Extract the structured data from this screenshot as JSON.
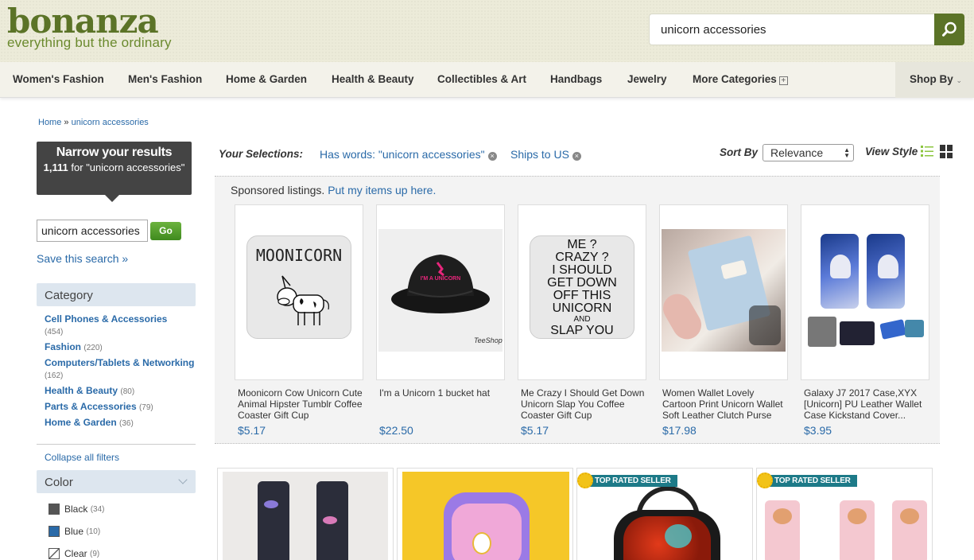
{
  "header": {
    "logo_word": "bonanza",
    "logo_tagline": "everything but the ordinary",
    "search_value": "unicorn accessories"
  },
  "nav": {
    "items": [
      "Women's Fashion",
      "Men's Fashion",
      "Home & Garden",
      "Health & Beauty",
      "Collectibles & Art",
      "Handbags",
      "Jewelry",
      "More Categories"
    ],
    "shop_by": "Shop By"
  },
  "breadcrumb": {
    "home": "Home",
    "separator": "»",
    "current": "unicorn accessories"
  },
  "narrow": {
    "title": "Narrow your results",
    "count": "1,111",
    "for_text": "for \"unicorn accessories\""
  },
  "side_search": {
    "value": "unicorn accessories",
    "go": "Go",
    "save": "Save this search »"
  },
  "category": {
    "heading": "Category",
    "items": [
      {
        "label": "Cell Phones & Accessories",
        "count": "(454)"
      },
      {
        "label": "Fashion",
        "count": "(220)"
      },
      {
        "label": "Computers/Tablets & Networking",
        "count": "(162)"
      },
      {
        "label": "Health & Beauty",
        "count": "(80)"
      },
      {
        "label": "Parts & Accessories",
        "count": "(79)"
      },
      {
        "label": "Home & Garden",
        "count": "(36)"
      }
    ]
  },
  "collapse_all": "Collapse all filters",
  "color": {
    "heading": "Color",
    "items": [
      {
        "label": "Black",
        "count": "(34)",
        "swatch": "#555555"
      },
      {
        "label": "Blue",
        "count": "(10)",
        "swatch": "#2a6aa8"
      },
      {
        "label": "Clear",
        "count": "(9)",
        "swatch": "#ffffff"
      }
    ]
  },
  "selections": {
    "label": "Your Selections:",
    "tags": [
      "Has words: \"unicorn accessories\"",
      "Ships to US"
    ]
  },
  "sort": {
    "label": "Sort By",
    "value": "Relevance"
  },
  "view_style": {
    "label": "View Style"
  },
  "sponsored": {
    "text": "Sponsored listings.",
    "link": "Put my items up here.",
    "items": [
      {
        "title": "Moonicorn Cow Unicorn Cute Animal Hipster Tumblr Coffee Coaster Gift Cup",
        "price": "$5.17",
        "image_text": "MOONICORN"
      },
      {
        "title": "I'm a Unicorn 1 bucket hat",
        "price": "$22.50",
        "image_text": "I'M A UNICORN",
        "image_mark": "TeeShop"
      },
      {
        "title": "Me Crazy I Should Get Down Unicorn Slap You Coffee Coaster Gift Cup",
        "price": "$5.17",
        "image_lines": [
          "ME ?",
          "CRAZY ?",
          "I SHOULD",
          "GET DOWN",
          "OFF THIS",
          "UNICORN",
          "AND",
          "SLAP YOU"
        ]
      },
      {
        "title": "Women Wallet Lovely Cartoon Print Unicorn Wallet Soft Leather Clutch Purse",
        "price": "$17.98"
      },
      {
        "title": "Galaxy J7 2017 Case,XYX [Unicorn] PU Leather Wallet Case Kickstand Cover...",
        "price": "$3.95"
      }
    ]
  },
  "results": {
    "badge": "TOP RATED SELLER"
  },
  "colors": {
    "brand": "#5b7327",
    "link": "#2a6aa8",
    "go": "#4a9a25",
    "badge": "#1d7a88"
  }
}
